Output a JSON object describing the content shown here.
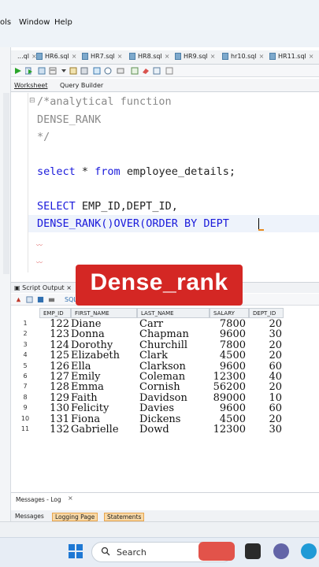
{
  "menu": {
    "tools_fragment": "ols",
    "window": "Window",
    "help": "Help"
  },
  "file_tabs": [
    {
      "label": "...ql"
    },
    {
      "label": "HR6.sql"
    },
    {
      "label": "HR7.sql"
    },
    {
      "label": "HR8.sql"
    },
    {
      "label": "HR9.sql"
    },
    {
      "label": "hr10.sql"
    },
    {
      "label": "HR11.sql"
    }
  ],
  "sub_tabs": {
    "worksheet": "Worksheet",
    "query_builder": "Query Builder"
  },
  "editor": {
    "lines": [
      {
        "text": "/*analytical function",
        "kind": "comment"
      },
      {
        "text": "DENSE_RANK",
        "kind": "comment"
      },
      {
        "text": "*/",
        "kind": "comment"
      },
      {
        "kw1": "select",
        "mid": " * ",
        "kw2": "from",
        "rest": " employee_details;"
      },
      {
        "kw1": "SELECT",
        "rest": " EMP_ID,DEPT_ID,"
      },
      {
        "kw1": "DENSE_RANK",
        "mid": "()",
        "kw2": "OVER",
        "rest2": "(ORDER BY DEPT"
      }
    ]
  },
  "banner": {
    "text": "Dense_rank",
    "color": "#d42724"
  },
  "results": {
    "tab_label": "Script Output",
    "toolbar_label": "SQL",
    "columns": [
      "EMP_ID",
      "FIRST_NAME",
      "LAST_NAME",
      "SALARY",
      "DEPT_ID"
    ],
    "rows": [
      [
        "1",
        "122",
        "Diane",
        "Carr",
        "7800",
        "20"
      ],
      [
        "2",
        "123",
        "Donna",
        "Chapman",
        "9600",
        "30"
      ],
      [
        "3",
        "124",
        "Dorothy",
        "Churchill",
        "7800",
        "20"
      ],
      [
        "4",
        "125",
        "Elizabeth",
        "Clark",
        "4500",
        "20"
      ],
      [
        "5",
        "126",
        "Ella",
        "Clarkson",
        "9600",
        "60"
      ],
      [
        "6",
        "127",
        "Emily",
        "Coleman",
        "12300",
        "40"
      ],
      [
        "7",
        "128",
        "Emma",
        "Cornish",
        "56200",
        "20"
      ],
      [
        "8",
        "129",
        "Faith",
        "Davidson",
        "89000",
        "10"
      ],
      [
        "9",
        "130",
        "Felicity",
        "Davies",
        "9600",
        "60"
      ],
      [
        "10",
        "131",
        "Fiona",
        "Dickens",
        "4500",
        "20"
      ],
      [
        "11",
        "132",
        "Gabrielle",
        "Dowd",
        "12300",
        "30"
      ]
    ]
  },
  "messages": {
    "title": "Messages - Log",
    "tabs": [
      "Messages",
      "Logging Page",
      "Statements"
    ]
  },
  "taskbar": {
    "search_label": "Search"
  }
}
